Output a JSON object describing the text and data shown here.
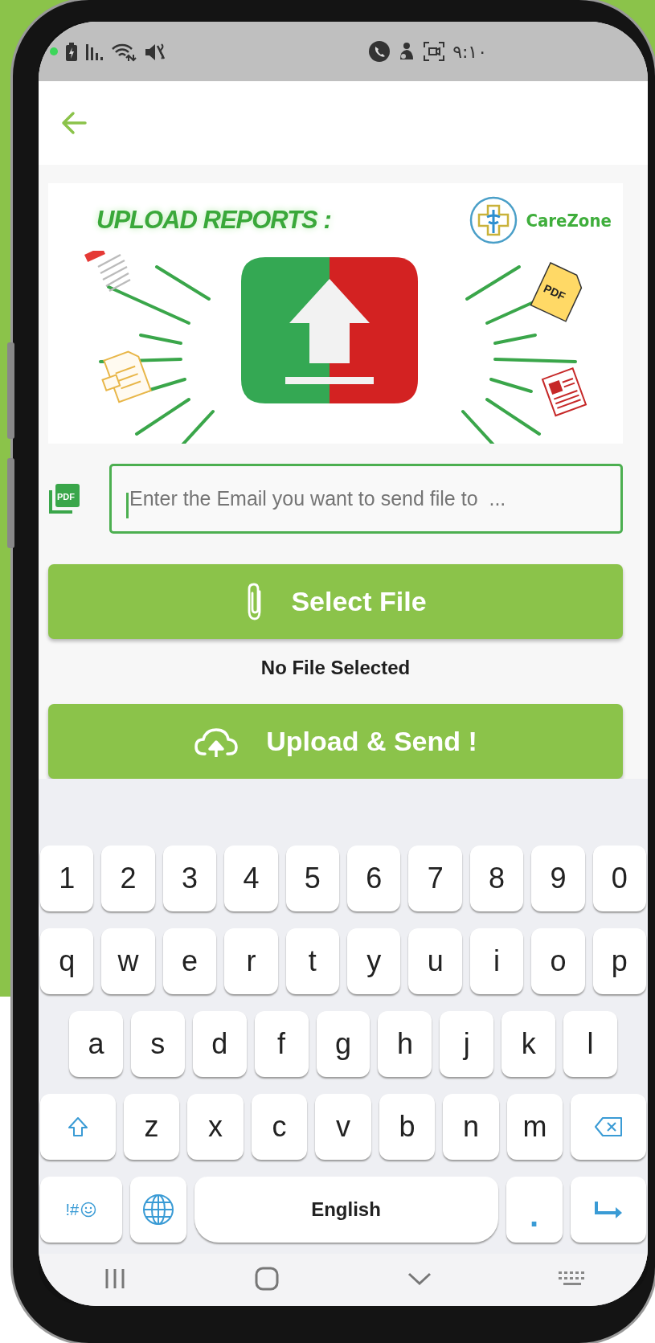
{
  "status_bar": {
    "time": "٩:١٠"
  },
  "banner": {
    "title": "UPLOAD REPORTS :",
    "brand": "CareZone",
    "file_badge": "PDF"
  },
  "email_field": {
    "icon_label": "PDF",
    "placeholder": "Enter the Email you want to send file to  ...",
    "focused": true
  },
  "select_button": {
    "label": "Select File"
  },
  "file_status": "No File Selected",
  "upload_button": {
    "label": "Upload & Send !"
  },
  "keyboard": {
    "rows": [
      [
        {
          "kind": "char",
          "label": "1"
        },
        {
          "kind": "char",
          "label": "2"
        },
        {
          "kind": "char",
          "label": "3"
        },
        {
          "kind": "char",
          "label": "4"
        },
        {
          "kind": "char",
          "label": "5"
        },
        {
          "kind": "char",
          "label": "6"
        },
        {
          "kind": "char",
          "label": "7"
        },
        {
          "kind": "char",
          "label": "8"
        },
        {
          "kind": "char",
          "label": "9"
        },
        {
          "kind": "char",
          "label": "0"
        }
      ],
      [
        {
          "kind": "char",
          "label": "q"
        },
        {
          "kind": "char",
          "label": "w"
        },
        {
          "kind": "char",
          "label": "e"
        },
        {
          "kind": "char",
          "label": "r"
        },
        {
          "kind": "char",
          "label": "t"
        },
        {
          "kind": "char",
          "label": "y"
        },
        {
          "kind": "char",
          "label": "u"
        },
        {
          "kind": "char",
          "label": "i"
        },
        {
          "kind": "char",
          "label": "o"
        },
        {
          "kind": "char",
          "label": "p"
        }
      ],
      [
        {
          "kind": "char",
          "label": "a"
        },
        {
          "kind": "char",
          "label": "s"
        },
        {
          "kind": "char",
          "label": "d"
        },
        {
          "kind": "char",
          "label": "f"
        },
        {
          "kind": "char",
          "label": "g"
        },
        {
          "kind": "char",
          "label": "h"
        },
        {
          "kind": "char",
          "label": "j"
        },
        {
          "kind": "char",
          "label": "k"
        },
        {
          "kind": "char",
          "label": "l"
        }
      ],
      [
        {
          "kind": "shift"
        },
        {
          "kind": "char",
          "label": "z"
        },
        {
          "kind": "char",
          "label": "x"
        },
        {
          "kind": "char",
          "label": "c"
        },
        {
          "kind": "char",
          "label": "v"
        },
        {
          "kind": "char",
          "label": "b"
        },
        {
          "kind": "char",
          "label": "n"
        },
        {
          "kind": "char",
          "label": "m"
        },
        {
          "kind": "backspace"
        }
      ],
      [
        {
          "kind": "symbols",
          "label": "!#"
        },
        {
          "kind": "globe"
        },
        {
          "kind": "space",
          "label": "English"
        },
        {
          "kind": "period",
          "label": "."
        },
        {
          "kind": "enter"
        }
      ]
    ]
  }
}
